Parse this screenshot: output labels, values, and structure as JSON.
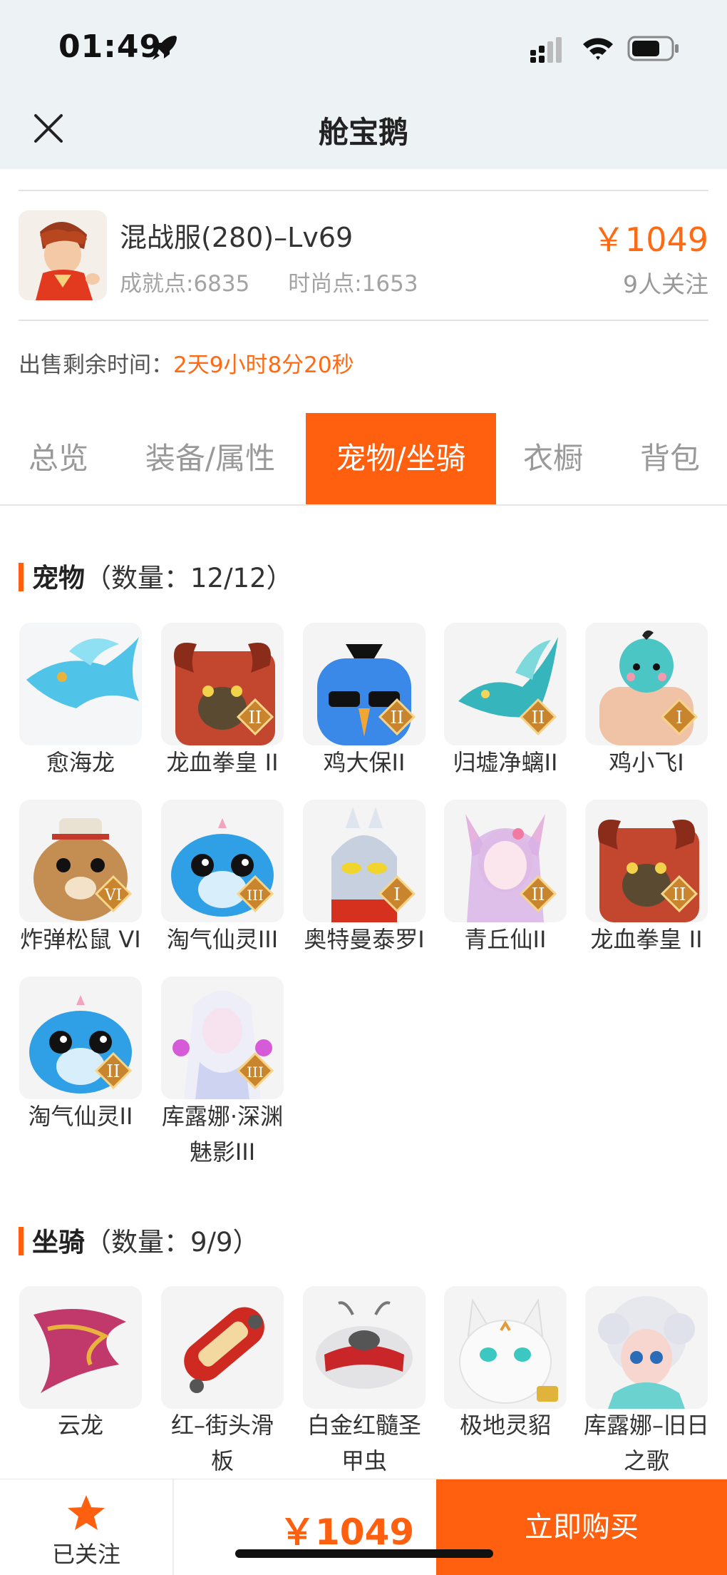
{
  "status_bar": {
    "time": "01:49"
  },
  "nav": {
    "title": "舱宝鹅"
  },
  "item": {
    "name": "混战服(280)–Lv69",
    "achievement": "成就点:6835",
    "fashion": "时尚点:1653",
    "price": "￥1049",
    "followers": "9人关注"
  },
  "sale": {
    "label": "出售剩余时间：",
    "value": "2天9小时8分20秒"
  },
  "tabs": [
    "总览",
    "装备/属性",
    "宠物/坐骑",
    "衣橱",
    "背包"
  ],
  "pets": {
    "title": "宠物",
    "count": "（数量：12/12）",
    "items": [
      {
        "name": "愈海龙",
        "rank": ""
      },
      {
        "name": "龙血拳皇 II",
        "rank": "II"
      },
      {
        "name": "鸡大保II",
        "rank": "II"
      },
      {
        "name": "归墟净螭II",
        "rank": "II"
      },
      {
        "name": "鸡小飞I",
        "rank": "I"
      },
      {
        "name": "炸弹松鼠 VI",
        "rank": "VI"
      },
      {
        "name": "淘气仙灵III",
        "rank": "III"
      },
      {
        "name": "奥特曼泰罗I",
        "rank": "I"
      },
      {
        "name": "青丘仙II",
        "rank": "II"
      },
      {
        "name": "龙血拳皇 II",
        "rank": "II"
      },
      {
        "name": "淘气仙灵II",
        "rank": "II"
      },
      {
        "name": "库露娜·深渊魅影III",
        "rank": "III"
      }
    ]
  },
  "mounts": {
    "title": "坐骑",
    "count": "（数量：9/9）",
    "items": [
      {
        "name": "云龙"
      },
      {
        "name": "红–街头滑板"
      },
      {
        "name": "白金红髓圣甲虫"
      },
      {
        "name": "极地灵貂"
      },
      {
        "name": "库露娜–旧日之歌"
      }
    ]
  },
  "bottom": {
    "follow_label": "已关注",
    "price": "￥1049",
    "buy_label": "立即购买"
  },
  "colors": {
    "accent": "#ff6010",
    "price": "#ff6a13"
  }
}
